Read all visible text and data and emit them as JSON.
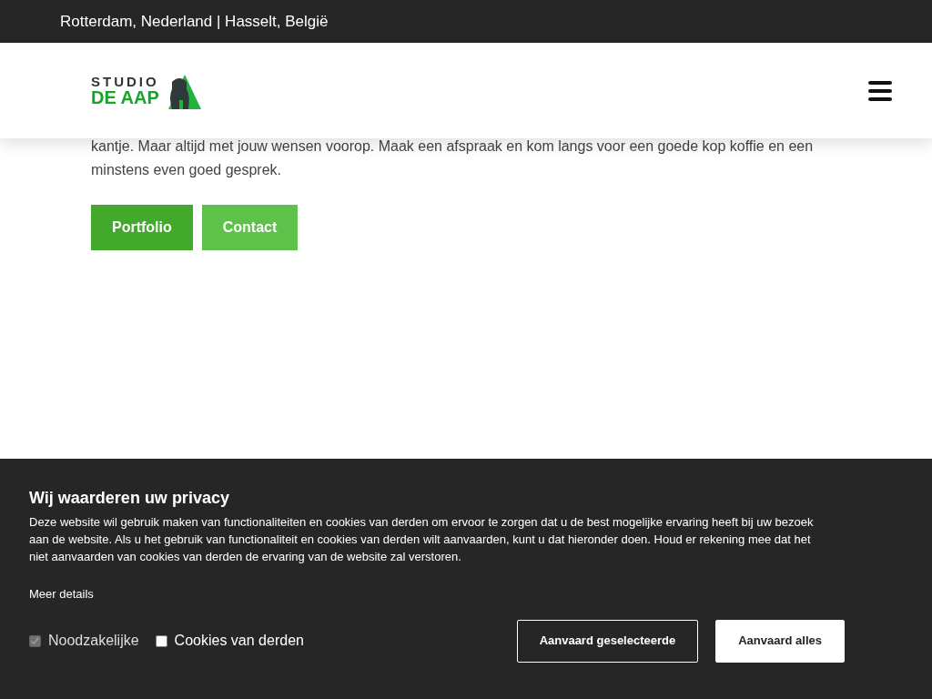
{
  "top_bar": {
    "locations": "Rotterdam, Nederland | Hasselt, België"
  },
  "logo": {
    "line_1": "STUDIO",
    "line_2": "DE AAP"
  },
  "intro": {
    "text": "kantje. Maar altijd met jouw wensen voorop. Maak een afspraak en kom langs voor een goede kop koffie en een minstens even goed gesprek."
  },
  "buttons": [
    {
      "label": "Portfolio",
      "kind": "primary"
    },
    {
      "label": "Contact",
      "kind": "secondary"
    }
  ],
  "cookie_banner": {
    "title": "Wij waarderen uw privacy",
    "text": "Deze website wil gebruik maken van functionaliteiten en cookies van derden om ervoor te zorgen dat u de best mogelijke ervaring heeft bij uw bezoek aan de website. Als u het gebruik van functionaliteit en cookies van derden wilt aanvaarden, kunt u dat hieronder doen. Houd er rekening mee dat het niet aanvaarden van cookies van derden de ervaring van de website zal verstoren.",
    "details_link": "Meer details",
    "options": [
      {
        "label": "Noodzakelijke",
        "checked": true,
        "disabled": true
      },
      {
        "label": "Cookies van derden",
        "checked": false,
        "disabled": false
      }
    ],
    "actions": [
      {
        "label": "Aanvaard geselecteerde",
        "kind": "outline"
      },
      {
        "label": "Aanvaard alles",
        "kind": "solid"
      }
    ]
  }
}
